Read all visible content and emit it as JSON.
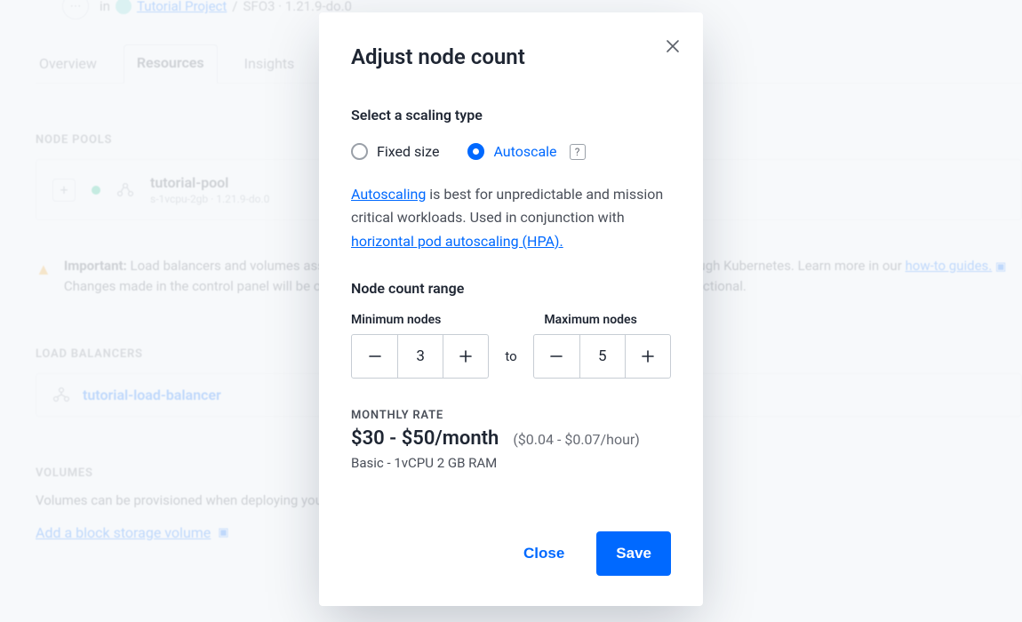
{
  "breadcrumb": {
    "in": "in",
    "project": "Tutorial Project",
    "tail": "SFO3 · 1.21.9-do.0"
  },
  "tabs": {
    "overview": "Overview",
    "resources": "Resources",
    "insights": "Insights"
  },
  "sections": {
    "node_pools": "NODE POOLS",
    "load_balancers": "LOAD BALANCERS",
    "volumes": "VOLUMES"
  },
  "pool": {
    "name": "tutorial-pool",
    "sub": "s-1vcpu-2gb · 1.21.9-do.0"
  },
  "notice": {
    "important": "Important:",
    "text1": " Load balancers and volumes associated with this cluster have to be deployed and managed through Kubernetes. Learn more in our ",
    "howto": "how-to guides.",
    "text2": " Changes made in the control panel will be overwritten by the service's reconciler or make the service non-functional."
  },
  "lb": {
    "name": "tutorial-load-balancer"
  },
  "volumes": {
    "text": "Volumes can be provisioned when deploying your service.",
    "add": "Add a block storage volume"
  },
  "modal": {
    "title": "Adjust node count",
    "select_label": "Select a scaling type",
    "fixed": "Fixed size",
    "autoscale": "Autoscale",
    "desc_pre": "",
    "desc_link1": "Autoscaling",
    "desc_mid": " is best for unpredictable and mission critical workloads. Used in conjunction with ",
    "desc_link2": "horizontal pod autoscaling (HPA).",
    "range_label": "Node count range",
    "min_label": "Minimum nodes",
    "max_label": "Maximum nodes",
    "to": "to",
    "min_value": "3",
    "max_value": "5",
    "rate_label": "MONTHLY RATE",
    "rate_main": "$30 - $50/month",
    "rate_sub": "($0.04 - $0.07/hour)",
    "rate_desc": "Basic - 1vCPU 2 GB RAM",
    "close": "Close",
    "save": "Save"
  }
}
